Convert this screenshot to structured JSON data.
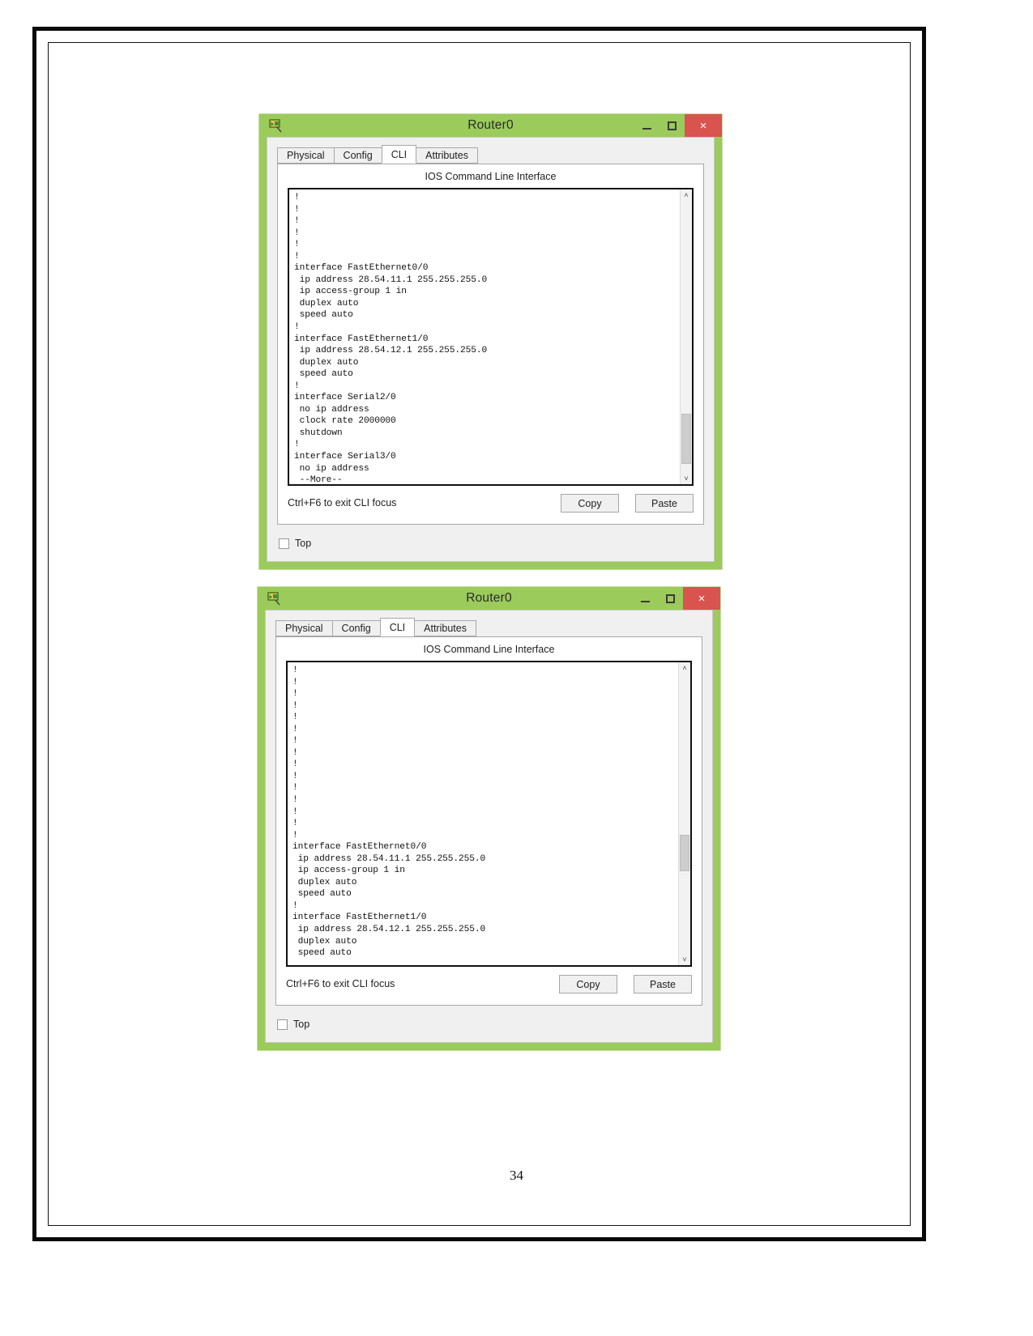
{
  "document": {
    "page_number": "34"
  },
  "colors": {
    "window_frame_green": "#9bcb5b",
    "close_button_red": "#d9534f",
    "terminal_text": "#111111"
  },
  "windows": [
    {
      "id": "router0-window-top",
      "title": "Router0",
      "app_icon": "packet-tracer-router-icon",
      "title_buttons": {
        "minimize": "minimize-icon",
        "maximize": "maximize-icon",
        "close": "×"
      },
      "tabs": [
        {
          "label": "Physical",
          "active": false
        },
        {
          "label": "Config",
          "active": false
        },
        {
          "label": "CLI",
          "active": true
        },
        {
          "label": "Attributes",
          "active": false
        }
      ],
      "cli_heading": "IOS Command Line Interface",
      "cli_text": "!\n!\n!\n!\n!\n!\ninterface FastEthernet0/0\n ip address 28.54.11.1 255.255.255.0\n ip access-group 1 in\n duplex auto\n speed auto\n!\ninterface FastEthernet1/0\n ip address 28.54.12.1 255.255.255.0\n duplex auto\n speed auto\n!\ninterface Serial2/0\n no ip address\n clock rate 2000000\n shutdown\n!\ninterface Serial3/0\n no ip address\n --More--",
      "scrollbar": {
        "up_arrow": "˄",
        "down_arrow": "˅",
        "thumb_top_pct": 76,
        "thumb_height_pct": 17
      },
      "footer_hint": "Ctrl+F6 to exit CLI focus",
      "copy_label": "Copy",
      "paste_label": "Paste",
      "top_checkbox_label": "Top",
      "top_checkbox_checked": false
    },
    {
      "id": "router0-window-bottom",
      "title": "Router0",
      "app_icon": "packet-tracer-router-icon",
      "title_buttons": {
        "minimize": "minimize-icon",
        "maximize": "maximize-icon",
        "close": "×"
      },
      "tabs": [
        {
          "label": "Physical",
          "active": false
        },
        {
          "label": "Config",
          "active": false
        },
        {
          "label": "CLI",
          "active": true
        },
        {
          "label": "Attributes",
          "active": false
        }
      ],
      "cli_heading": "IOS Command Line Interface",
      "cli_text": "!\n!\n!\n!\n!\n!\n!\n!\n!\n!\n!\n!\n!\n!\n!\ninterface FastEthernet0/0\n ip address 28.54.11.1 255.255.255.0\n ip access-group 1 in\n duplex auto\n speed auto\n!\ninterface FastEthernet1/0\n ip address 28.54.12.1 255.255.255.0\n duplex auto\n speed auto",
      "scrollbar": {
        "up_arrow": "˄",
        "down_arrow": "˅",
        "thumb_top_pct": 57,
        "thumb_height_pct": 12
      },
      "footer_hint": "Ctrl+F6 to exit CLI focus",
      "copy_label": "Copy",
      "paste_label": "Paste",
      "top_checkbox_label": "Top",
      "top_checkbox_checked": false
    }
  ]
}
